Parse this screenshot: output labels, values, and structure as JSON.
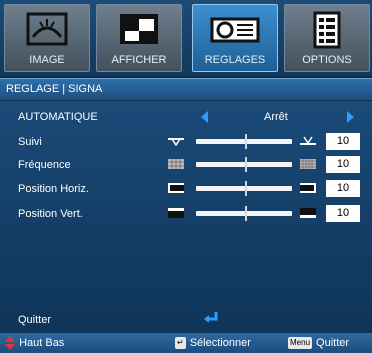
{
  "tabs": [
    {
      "label": "IMAGE",
      "icon": "image-icon",
      "active": false
    },
    {
      "label": "AFFICHER",
      "icon": "display-icon",
      "active": false
    },
    {
      "label": "REGLAGES",
      "icon": "projector-icon",
      "active": true
    },
    {
      "label": "OPTIONS",
      "icon": "options-icon",
      "active": false
    }
  ],
  "subheader": "REGLAGE | SIGNA",
  "rows": {
    "auto": {
      "label": "AUTOMATIQUE",
      "value": "Arrêt"
    },
    "suivi": {
      "label": "Suivi",
      "value": "10",
      "level": 0.52
    },
    "frequence": {
      "label": "Fréquence",
      "value": "10",
      "level": 0.52
    },
    "pos_h": {
      "label": "Position Horiz.",
      "value": "10",
      "level": 0.52
    },
    "pos_v": {
      "label": "Position Vert.",
      "value": "10",
      "level": 0.52
    }
  },
  "quit_label": "Quitter",
  "footer": {
    "nav": "Haut Bas",
    "select": "Sélectionner",
    "menu_key": "Menu",
    "quit": "Quitter"
  },
  "colors": {
    "accent": "#2d9bff",
    "panel": "#1a4a78",
    "nav_arrows": "#e8322e"
  }
}
